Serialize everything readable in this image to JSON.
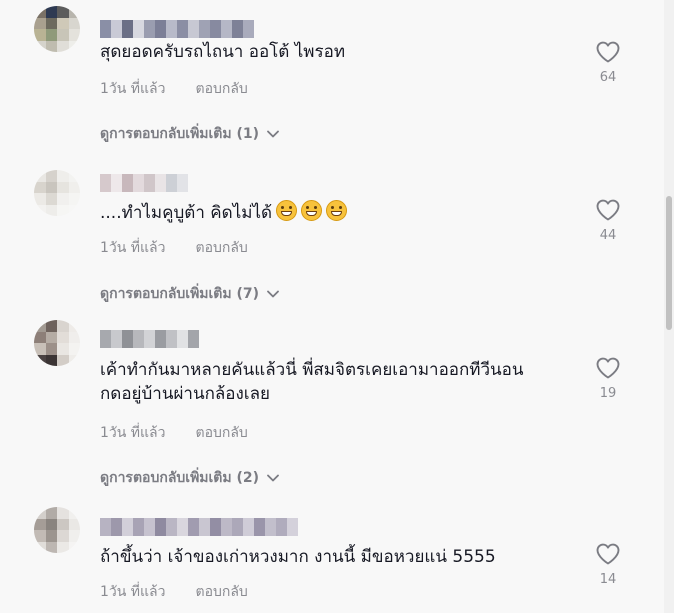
{
  "comments": [
    {
      "text": "สุดยอดครับรถไถนา ออโต้ ไพรอท",
      "time": "1วัน ที่แล้ว",
      "reply_label": "ตอบกลับ",
      "more_replies": "ดูการตอบกลับเพิ่มเติม (1)",
      "likes": "64"
    },
    {
      "text": "....ทำไมคูบูต้า คิดไม่ได้",
      "time": "1วัน ที่แล้ว",
      "reply_label": "ตอบกลับ",
      "more_replies": "ดูการตอบกลับเพิ่มเติม (7)",
      "likes": "44"
    },
    {
      "text": "เค้าทำกันมาหลายคันแล้วนี่ พี่สมจิตรเคยเอามาออกทีวีนอนกดอยู่บ้านผ่านกล้องเลย",
      "time": "1วัน ที่แล้ว",
      "reply_label": "ตอบกลับ",
      "more_replies": "ดูการตอบกลับเพิ่มเติม (2)",
      "likes": "19"
    },
    {
      "text": "ถ้าขึ้นว่า เจ้าของเก่าหวงมาก งานนี้ มีขอหวยแน่ 5555",
      "time": "1วัน ที่แล้ว",
      "reply_label": "ตอบกลับ",
      "likes": "14"
    }
  ],
  "icons": {
    "like": "heart-outline-icon",
    "expand": "chevron-down-icon"
  },
  "colors": {
    "background": "#f8f8f8",
    "secondary_text": "#8a8b91",
    "primary_text": "#161823"
  }
}
